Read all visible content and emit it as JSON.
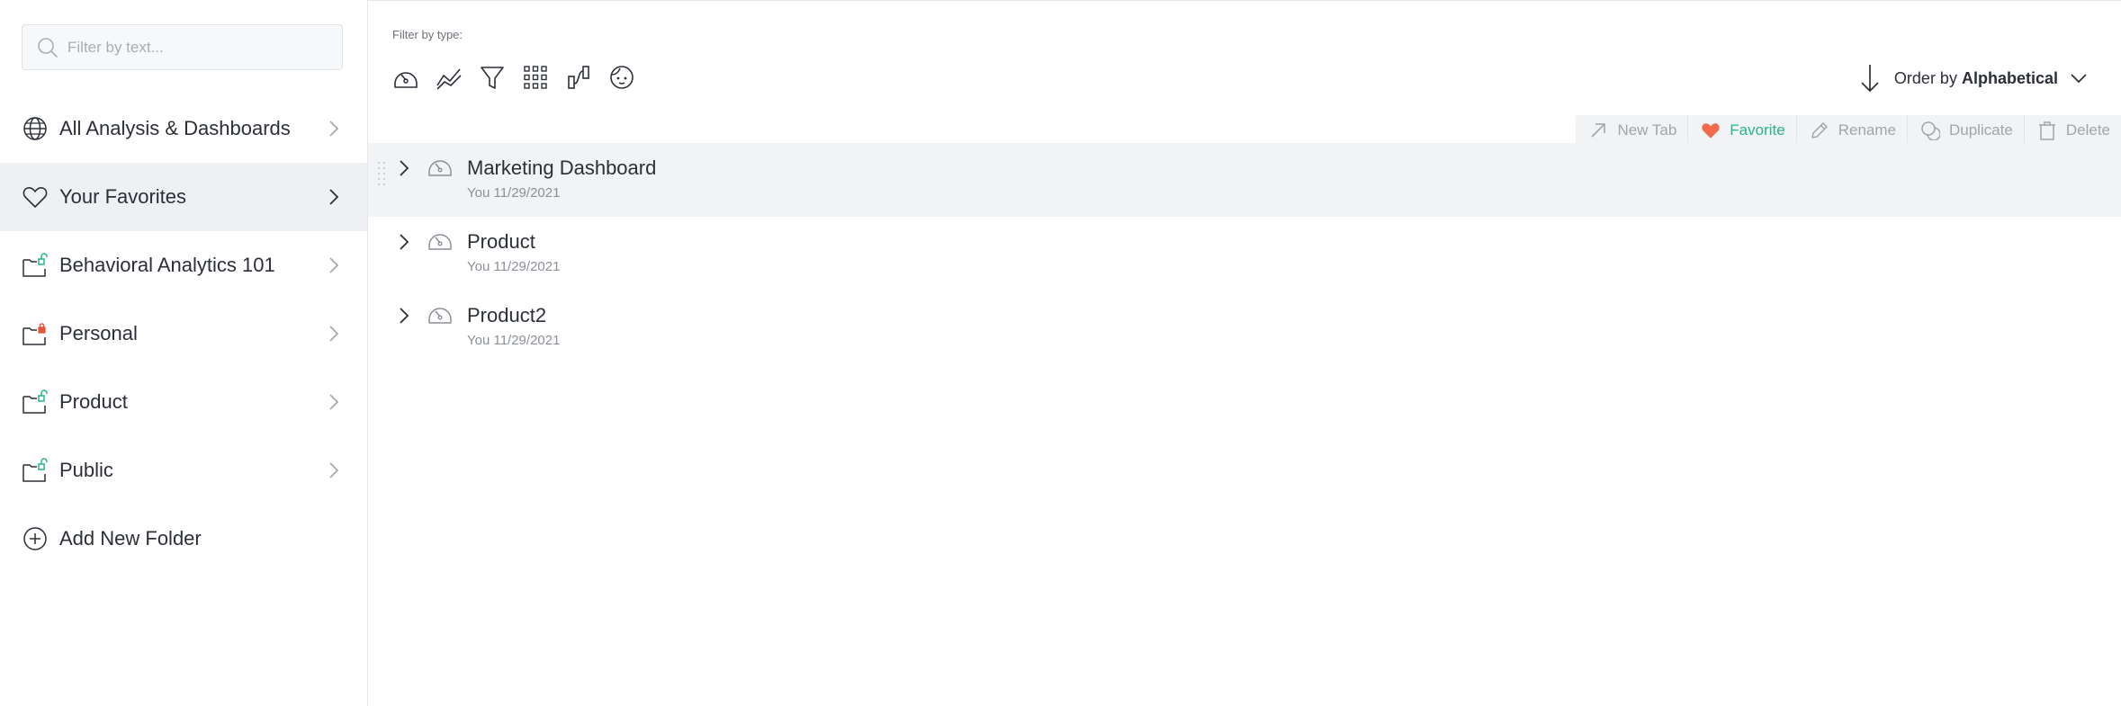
{
  "search": {
    "placeholder": "Filter by text..."
  },
  "sidebar": {
    "items": [
      {
        "label": "All Analysis & Dashboards",
        "icon": "globe-icon"
      },
      {
        "label": "Your Favorites",
        "icon": "heart-icon"
      },
      {
        "label": "Behavioral Analytics 101",
        "icon": "shared-folder-icon"
      },
      {
        "label": "Personal",
        "icon": "locked-folder-icon"
      },
      {
        "label": "Product",
        "icon": "shared-folder-icon"
      },
      {
        "label": "Public",
        "icon": "shared-folder-icon"
      }
    ],
    "add_folder_label": "Add New Folder",
    "active_index": 1
  },
  "filter": {
    "label": "Filter by type:",
    "types": [
      "dashboard-icon",
      "trends-icon",
      "funnel-icon",
      "grid-icon",
      "flow-icon",
      "user-face-icon"
    ]
  },
  "order": {
    "prefix": "Order by",
    "value": "Alphabetical"
  },
  "actions": {
    "new_tab": "New Tab",
    "favorite": "Favorite",
    "rename": "Rename",
    "duplicate": "Duplicate",
    "delete": "Delete"
  },
  "items": [
    {
      "name": "Marketing Dashboard",
      "meta": "You 11/29/2021"
    },
    {
      "name": "Product",
      "meta": "You 11/29/2021"
    },
    {
      "name": "Product2",
      "meta": "You 11/29/2021"
    }
  ],
  "colors": {
    "accent_green": "#27b48e",
    "favorite_heart": "#f26b4a",
    "lock_red": "#e5533d",
    "active_bg": "#eef0f3"
  }
}
